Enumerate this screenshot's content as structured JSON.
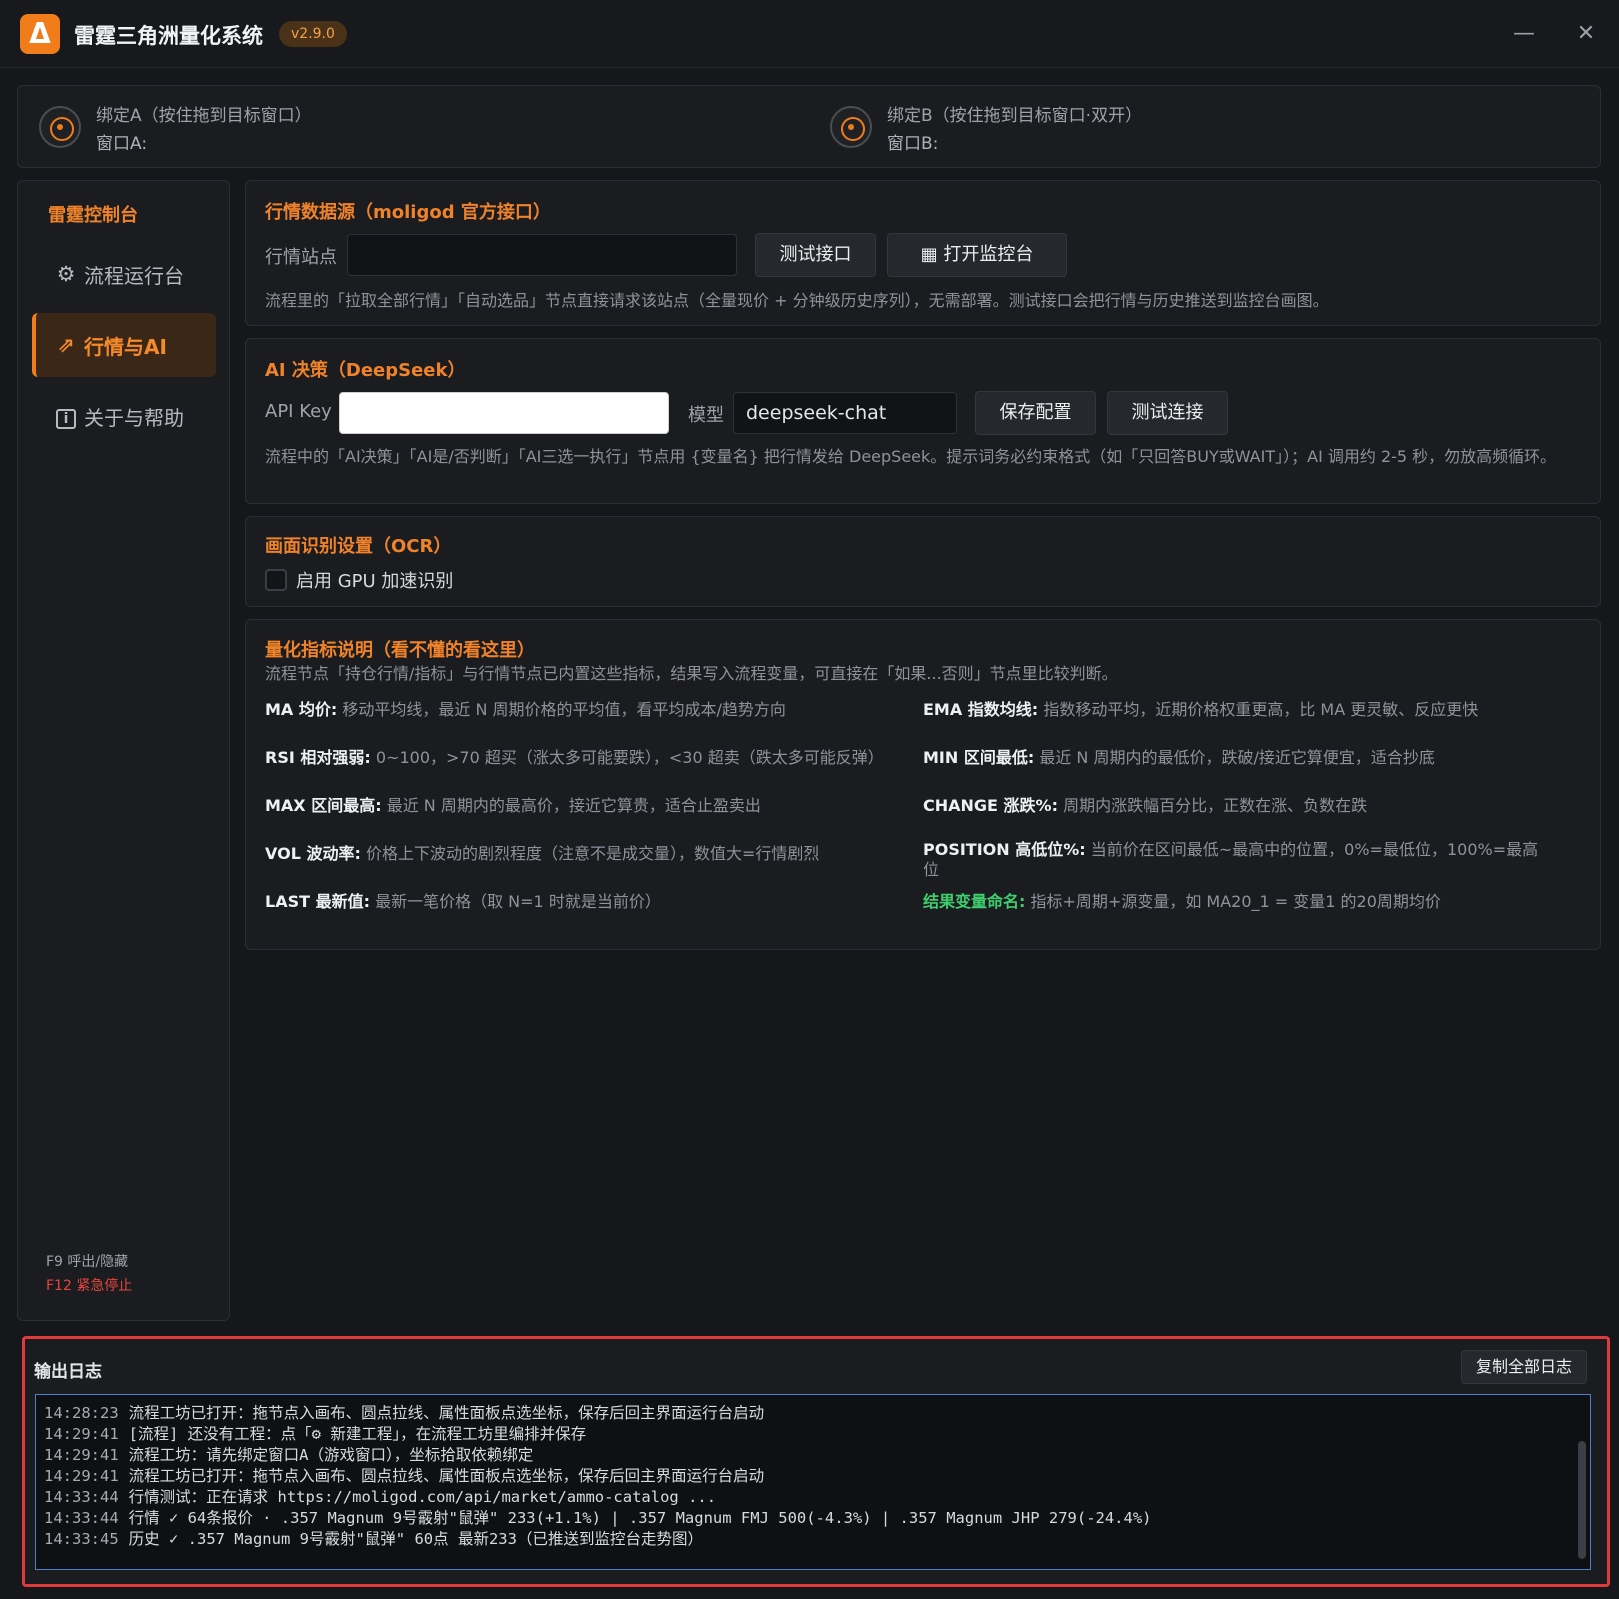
{
  "app": {
    "logo": "Δ",
    "title": "雷霆三角洲量化系统",
    "version": "v2.9.0",
    "minimize": "—",
    "close": "✕"
  },
  "bind": {
    "a_title": "绑定A（按住拖到目标窗口）",
    "a_window": "窗口A:",
    "b_title": "绑定B（按住拖到目标窗口·双开）",
    "b_window": "窗口B:"
  },
  "sidebar": {
    "title": "雷霆控制台",
    "items": [
      {
        "icon": "gear-icon",
        "glyph": "⚙",
        "label": "流程运行台"
      },
      {
        "icon": "chart-icon",
        "glyph": "⇗",
        "label": "行情与AI"
      },
      {
        "icon": "info-icon",
        "glyph": "i",
        "label": "关于与帮助"
      }
    ],
    "hotkey_toggle": "F9 呼出/隐藏",
    "hotkey_stop": "F12 紧急停止"
  },
  "market": {
    "title": "行情数据源（moligod 官方接口）",
    "site_label": "行情站点",
    "site_value": "",
    "test_button": "测试接口",
    "monitor_button": "打开监控台",
    "monitor_icon": "▦",
    "desc": "流程里的「拉取全部行情」「自动选品」节点直接请求该站点（全量现价 + 分钟级历史序列），无需部署。测试接口会把行情与历史推送到监控台画图。"
  },
  "ai": {
    "title": "AI 决策（DeepSeek）",
    "key_label": "API Key",
    "key_value": "",
    "model_label": "模型",
    "model_value": "deepseek-chat",
    "save_button": "保存配置",
    "test_button": "测试连接",
    "desc": "流程中的「AI决策」「AI是/否判断」「AI三选一执行」节点用 {变量名} 把行情发给 DeepSeek。提示词务必约束格式（如「只回答BUY或WAIT」）；AI 调用约 2-5 秒，勿放高频循环。"
  },
  "ocr": {
    "title": "画面识别设置（OCR）",
    "gpu_label": "启用 GPU 加速识别",
    "gpu_checked": false
  },
  "indicators": {
    "title": "量化指标说明（看不懂的看这里）",
    "intro": "流程节点「持仓行情/指标」与行情节点已内置这些指标，结果写入流程变量，可直接在「如果...否则」节点里比较判断。",
    "items": [
      {
        "name": "MA 均价:",
        "text": "移动平均线，最近 N 周期价格的平均值，看平均成本/趋势方向"
      },
      {
        "name": "EMA 指数均线:",
        "text": "指数移动平均，近期价格权重更高，比 MA 更灵敏、反应更快"
      },
      {
        "name": "RSI 相对强弱:",
        "text": "0~100，>70 超买（涨太多可能要跌），<30 超卖（跌太多可能反弹）"
      },
      {
        "name": "MIN 区间最低:",
        "text": "最近 N 周期内的最低价，跌破/接近它算便宜，适合抄底"
      },
      {
        "name": "MAX 区间最高:",
        "text": "最近 N 周期内的最高价，接近它算贵，适合止盈卖出"
      },
      {
        "name": "CHANGE 涨跌%:",
        "text": "周期内涨跌幅百分比，正数在涨、负数在跌"
      },
      {
        "name": "VOL 波动率:",
        "text": "价格上下波动的剧烈程度（注意不是成交量），数值大=行情剧烈"
      },
      {
        "name": "POSITION 高低位%:",
        "text": "当前价在区间最低~最高中的位置，0%=最低位，100%=最高位"
      },
      {
        "name": "LAST 最新值:",
        "text": "最新一笔价格（取 N=1 时就是当前价）"
      },
      {
        "name": "结果变量命名:",
        "text": "指标+周期+源变量，如 MA20_1 = 变量1 的20周期均价"
      }
    ]
  },
  "log": {
    "title": "输出日志",
    "copy_button": "复制全部日志",
    "lines": [
      {
        "time": "14:28:23",
        "text": "流程工坊已打开：拖节点入画布、圆点拉线、属性面板点选坐标，保存后回主界面运行台启动"
      },
      {
        "time": "14:29:41",
        "text": "[流程] 还没有工程：点「⚙ 新建工程」，在流程工坊里编排并保存"
      },
      {
        "time": "14:29:41",
        "text": "流程工坊：请先绑定窗口A（游戏窗口），坐标拾取依赖绑定"
      },
      {
        "time": "14:29:41",
        "text": "流程工坊已打开：拖节点入画布、圆点拉线、属性面板点选坐标，保存后回主界面运行台启动"
      },
      {
        "time": "14:33:44",
        "text": "行情测试：正在请求 https://moligod.com/api/market/ammo-catalog ..."
      },
      {
        "time": "14:33:44",
        "text": "行情 ✓ 64条报价 · .357 Magnum 9号霰射\"鼠弹\" 233(+1.1%) | .357 Magnum FMJ 500(-4.3%) | .357 Magnum JHP 279(-24.4%)"
      },
      {
        "time": "14:33:45",
        "text": "历史 ✓ .357 Magnum 9号霰射\"鼠弹\" 60点 最新233（已推送到监控台走势图）"
      }
    ]
  }
}
